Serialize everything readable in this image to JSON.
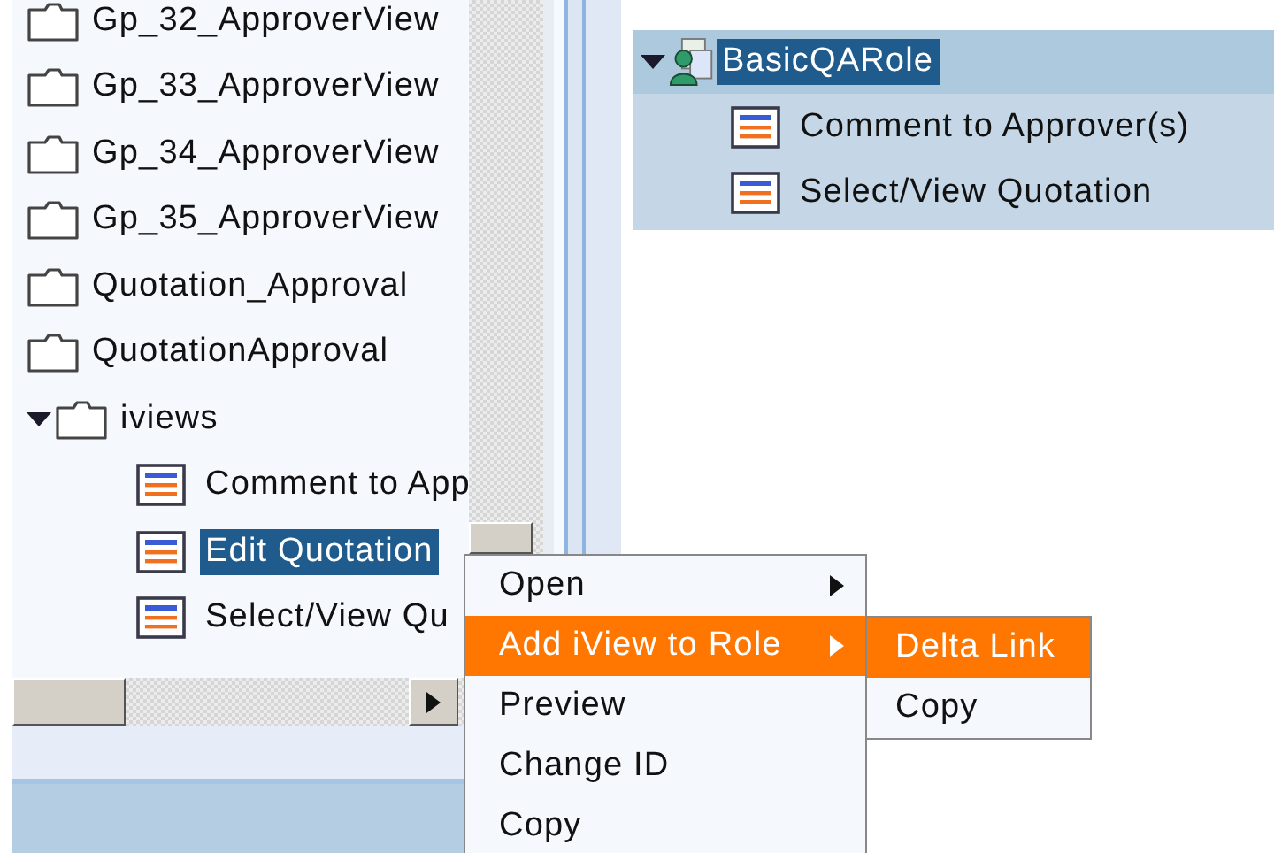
{
  "tree": {
    "items": [
      {
        "label": "Gp_32_ApproverView",
        "kind": "folder",
        "expanded": false,
        "selected": false
      },
      {
        "label": "Gp_33_ApproverView",
        "kind": "folder",
        "expanded": false,
        "selected": false
      },
      {
        "label": "Gp_34_ApproverView",
        "kind": "folder",
        "expanded": false,
        "selected": false
      },
      {
        "label": "Gp_35_ApproverView",
        "kind": "folder",
        "expanded": false,
        "selected": false
      },
      {
        "label": "Quotation_Approval",
        "kind": "folder",
        "expanded": false,
        "selected": false
      },
      {
        "label": "QuotationApproval",
        "kind": "folder",
        "expanded": false,
        "selected": false
      },
      {
        "label": "iviews",
        "kind": "folder",
        "expanded": true,
        "selected": false,
        "children": [
          {
            "label": "Comment to App",
            "kind": "iview",
            "selected": false
          },
          {
            "label": "Edit Quotation",
            "kind": "iview",
            "selected": true
          },
          {
            "label": "Select/View Qu",
            "kind": "iview",
            "selected": false
          }
        ]
      }
    ]
  },
  "role_tree": {
    "label": "BasicQARole",
    "expanded": true,
    "selected": true,
    "children": [
      {
        "label": "Comment to Approver(s)",
        "kind": "iview",
        "selected": false
      },
      {
        "label": "Select/View Quotation",
        "kind": "iview",
        "selected": false
      }
    ]
  },
  "context_menu": {
    "items": [
      {
        "label": "Open",
        "has_submenu": true,
        "selected": false
      },
      {
        "label": "Add iView to Role",
        "has_submenu": true,
        "selected": true
      },
      {
        "label": "Preview",
        "has_submenu": false,
        "selected": false
      },
      {
        "label": "Change ID",
        "has_submenu": false,
        "selected": false
      },
      {
        "label": "Copy",
        "has_submenu": false,
        "selected": false
      }
    ]
  },
  "submenu": {
    "items": [
      {
        "label": "Delta Link",
        "selected": true
      },
      {
        "label": "Copy",
        "selected": false
      }
    ]
  }
}
